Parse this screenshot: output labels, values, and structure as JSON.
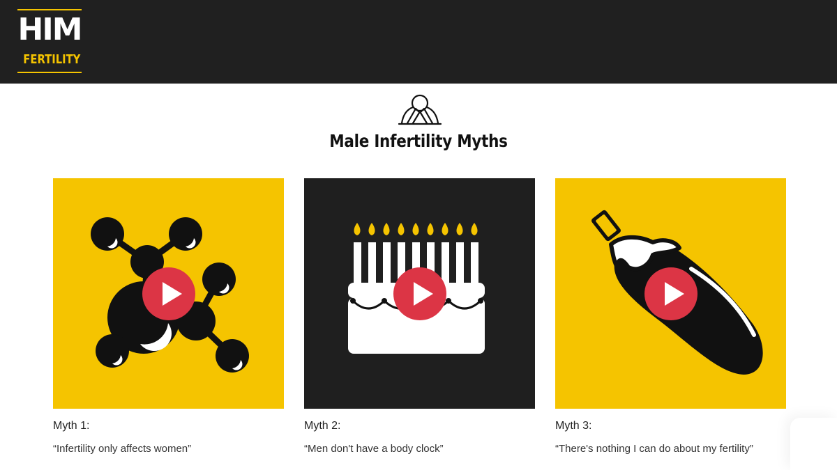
{
  "header": {
    "logo": {
      "name": "HIM FERTILITY logo",
      "line1": "HIM",
      "line2": "FERTILITY"
    },
    "colors": {
      "bar": "#202020",
      "brand": "#f5c400"
    }
  },
  "section": {
    "icon": "hands-over-face-icon",
    "title": "Male Infertility Myths"
  },
  "cards": [
    {
      "label": "Myth 1:",
      "quote": "“Infertility only affects women”",
      "background": "#f5c400",
      "illustration": "molecule-icon"
    },
    {
      "label": "Myth 2:",
      "quote": "“Men don't have a body clock”",
      "background": "#1f1f1f",
      "illustration": "birthday-cake-icon"
    },
    {
      "label": "Myth 3:",
      "quote": "“There's nothing I can do about my fertility”",
      "background": "#f5c400",
      "illustration": "eggplant-icon"
    }
  ],
  "play_button": {
    "icon": "play-icon",
    "color": "#dc3545"
  }
}
